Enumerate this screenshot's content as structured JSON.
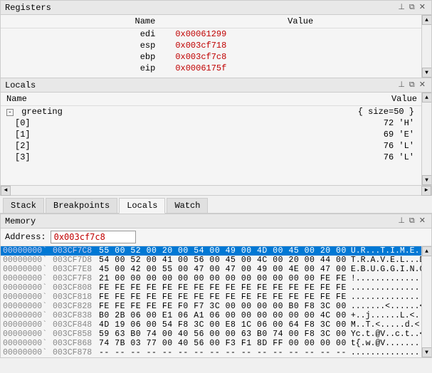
{
  "registers": {
    "title": "Registers",
    "columns": [
      "Name",
      "Value"
    ],
    "rows": [
      {
        "name": "edi",
        "value": "0x00061299"
      },
      {
        "name": "esp",
        "value": "0x003cf718"
      },
      {
        "name": "ebp",
        "value": "0x003cf7c8"
      },
      {
        "name": "eip",
        "value": "0x0006175f"
      }
    ]
  },
  "locals": {
    "title": "Locals",
    "columns": [
      "Name",
      "Value"
    ],
    "greeting": {
      "name": "greeting",
      "value": "{ size=50 }",
      "children": [
        {
          "index": "[0]",
          "value": "72 'H'"
        },
        {
          "index": "[1]",
          "value": "69 'E'"
        },
        {
          "index": "[2]",
          "value": "76 'L'"
        },
        {
          "index": "[3]",
          "value": "76 'L'"
        }
      ]
    }
  },
  "tabs": [
    "Stack",
    "Breakpoints",
    "Locals",
    "Watch"
  ],
  "active_tab": "Locals",
  "memory": {
    "title": "Memory",
    "address_label": "Address:",
    "address_value": "0x003cf7c8",
    "rows": [
      {
        "addr1": "00000000`",
        "addr2": "003CF7C8",
        "hex": "55 00 52 00 20 00 54 00 49 00 4D 00 45 00 20 00",
        "ascii": "U.R...T.I.M.E. .",
        "selected": true
      },
      {
        "addr1": "00000000`",
        "addr2": "003CF7D8",
        "hex": "54 00 52 00 41 00 56 00 45 00 4C 00 20 00 44 00",
        "ascii": "T.R.A.V.E.L...D.",
        "selected": false
      },
      {
        "addr1": "00000000`",
        "addr2": "003CF7E8",
        "hex": "45 00 42 00 55 00 47 00 47 00 49 00 4E 00 47 00",
        "ascii": "E.B.U.G.G.I.N.G.",
        "selected": false
      },
      {
        "addr1": "00000000`",
        "addr2": "003CF7F8",
        "hex": "21 00 00 00 00 00 00 00 00 00 00 00 00 00 FE FE",
        "ascii": "!...............",
        "selected": false
      },
      {
        "addr1": "00000000`",
        "addr2": "003CF808",
        "hex": "FE FE FE FE FE FE FE FE FE FE FE FE FE FE FE FE",
        "ascii": "................",
        "selected": false
      },
      {
        "addr1": "00000000`",
        "addr2": "003CF818",
        "hex": "FE FE FE FE FE FE FE FE FE FE FE FE FE FE FE FE",
        "ascii": "................",
        "selected": false
      },
      {
        "addr1": "00000000`",
        "addr2": "003CF828",
        "hex": "FE FE FE FE FE F0 F7 3C 00 00 00 00 B0 F8 3C 00",
        "ascii": ".......<......<.",
        "selected": false
      },
      {
        "addr1": "00000000`",
        "addr2": "003CF838",
        "hex": "B0 2B 06 00 E1 06 A1 06 00 00 00 00 00 00 4C 00",
        "ascii": "+..j......L.<.",
        "selected": false
      },
      {
        "addr1": "00000000`",
        "addr2": "003CF848",
        "hex": "4D 19 06 00 54 F8 3C 00 E8 1C 06 00 64 F8 3C 00",
        "ascii": "M..T.<.....d.<.",
        "selected": false
      },
      {
        "addr1": "00000000`",
        "addr2": "003CF858",
        "hex": "59 63 B0 74 00 40 56 00 00 63 B0 74 00 F8 3C 00",
        "ascii": "Yc.t.@V..c.t..<.",
        "selected": false
      },
      {
        "addr1": "00000000`",
        "addr2": "003CF868",
        "hex": "74 7B 03 77 00 40 56 00 F3 F1 8D FF 00 00 00 00",
        "ascii": "t{.w.@V.........",
        "selected": false
      },
      {
        "addr1": "00000000`",
        "addr2": "003CF878",
        "hex": "-- -- -- -- -- -- -- -- -- -- -- -- -- -- -- --",
        "ascii": "................",
        "selected": false
      }
    ]
  },
  "icons": {
    "pin": "📌",
    "close": "✕",
    "arrow_up": "▲",
    "arrow_down": "▼",
    "arrow_left": "◄",
    "arrow_right": "►",
    "expand": "-",
    "collapse": "+"
  }
}
